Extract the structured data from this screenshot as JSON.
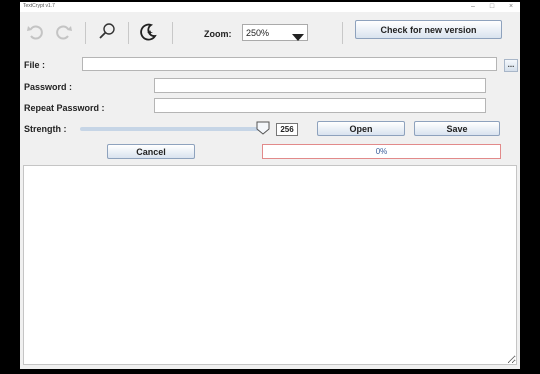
{
  "window": {
    "title": "TextCrypt v1.7",
    "controls": {
      "minimize": "–",
      "maximize": "□",
      "close": "×"
    }
  },
  "toolbar": {
    "icons": [
      "undo-icon",
      "redo-icon",
      "search-icon",
      "night-mode-icon"
    ],
    "zoom_label": "Zoom:",
    "zoom_value": "250%",
    "check_update_label": "Check for new version"
  },
  "form": {
    "file_label": "File :",
    "file_value": "",
    "browse_label": "...",
    "password_label": "Password :",
    "password_value": "",
    "repeat_password_label": "Repeat Password :",
    "repeat_password_value": "",
    "strength_label": "Strength :",
    "strength_value": "256",
    "strength_fraction": 1.0,
    "open_label": "Open",
    "save_label": "Save",
    "cancel_label": "Cancel"
  },
  "progress": {
    "text": "0%",
    "value": 0
  },
  "editor": {
    "content": ""
  }
}
